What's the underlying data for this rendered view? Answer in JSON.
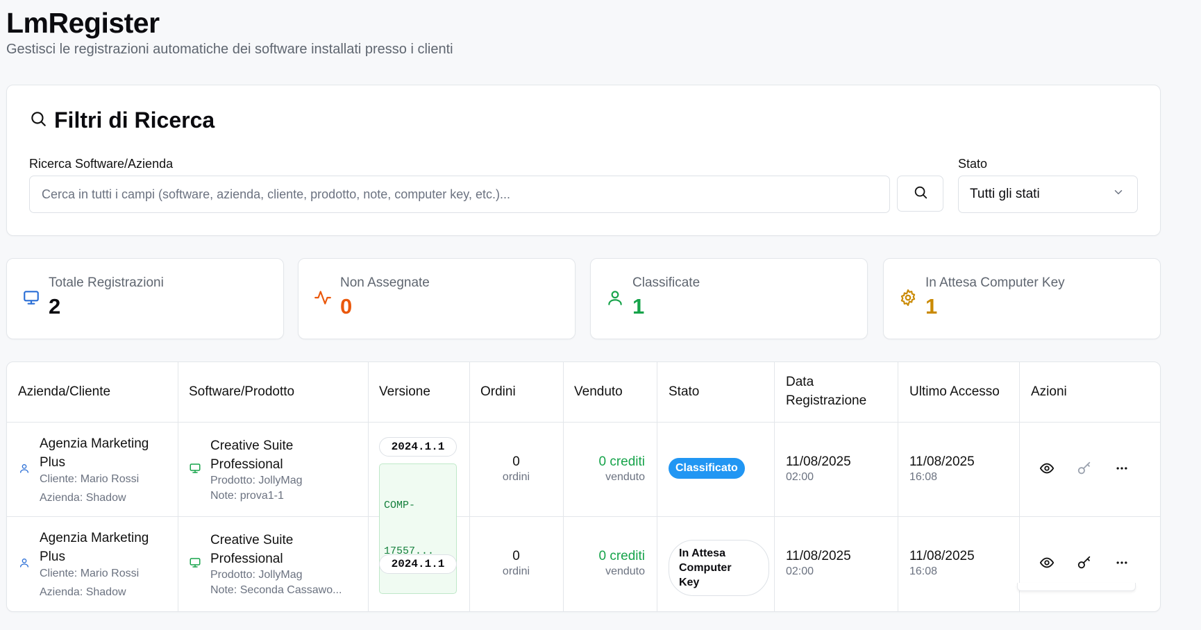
{
  "app": {
    "title": "LmRegister",
    "subtitle": "Gestisci le registrazioni automatiche dei software installati presso i clienti"
  },
  "filters": {
    "title": "Filtri di Ricerca",
    "search_label": "Ricerca Software/Azienda",
    "search_placeholder": "Cerca in tutti i campi (software, azienda, cliente, prodotto, note, computer key, etc.)...",
    "search_value": "",
    "status_label": "Stato",
    "status_selected": "Tutti gli stati"
  },
  "stats": [
    {
      "label": "Totale Registrazioni",
      "value": "2",
      "icon": "monitor-icon",
      "color": "#2b6fd6"
    },
    {
      "label": "Non Assegnate",
      "value": "0",
      "icon": "activity-icon",
      "color": "#ea580c"
    },
    {
      "label": "Classificate",
      "value": "1",
      "icon": "user-icon",
      "color": "#16a34a"
    },
    {
      "label": "In Attesa Computer Key",
      "value": "1",
      "icon": "gear-icon",
      "color": "#ca8a04"
    }
  ],
  "table": {
    "headers": {
      "company": "Azienda/Cliente",
      "software": "Software/Prodotto",
      "version": "Versione",
      "orders": "Ordini",
      "sold": "Venduto",
      "status": "Stato",
      "reg_date_1": "Data",
      "reg_date_2": "Registrazione",
      "last_access": "Ultimo Accesso",
      "actions": "Azioni"
    },
    "rows": [
      {
        "company_1": "Agenzia Marketing",
        "company_2": "Plus",
        "client": "Cliente: Mario Rossi",
        "azienda": "Azienda: Shadow",
        "software_1": "Creative Suite",
        "software_2": "Professional",
        "product": "Prodotto: JollyMag",
        "note": "Note: prova1-1",
        "version": "2024.1.1",
        "computer_key_1": "COMP-",
        "computer_key_2": "17557...",
        "orders": "0",
        "orders_unit": "ordini",
        "sold": "0 crediti",
        "sold_unit": "venduto",
        "status": "Classificato",
        "reg_date": "11/08/2025",
        "reg_time": "02:00",
        "last_date": "11/08/2025",
        "last_time": "16:08"
      },
      {
        "company_1": "Agenzia Marketing",
        "company_2": "Plus",
        "client": "Cliente: Mario Rossi",
        "azienda": "Azienda: Shadow",
        "software_1": "Creative Suite",
        "software_2": "Professional",
        "product": "Prodotto: JollyMag",
        "note": "Note: Seconda Cassawo...",
        "version": "2024.1.1",
        "orders": "0",
        "orders_unit": "ordini",
        "sold": "0 crediti",
        "sold_unit": "venduto",
        "status_1": "In Attesa",
        "status_2": "Computer",
        "status_3": "Key",
        "reg_date": "11/08/2025",
        "reg_time": "02:00",
        "last_date": "11/08/2025",
        "last_time": "16:08"
      }
    ]
  }
}
